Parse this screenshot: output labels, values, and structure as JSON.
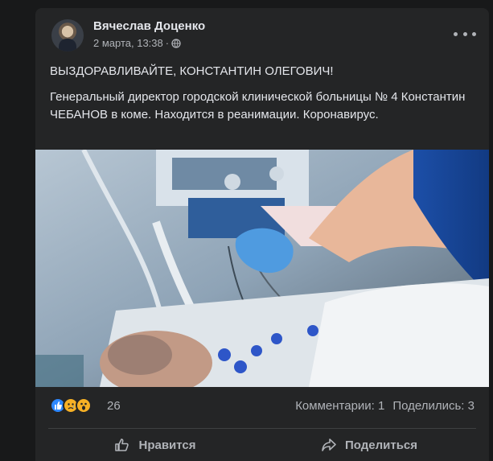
{
  "post": {
    "author": "Вячеслав Доценко",
    "date": "2 марта, 13:38",
    "separator": "·",
    "title": "ВЫЗДОРАВЛИВАЙТЕ, КОНСТАНТИН ОЛЕГОВИЧ!",
    "body": "Генеральный директор городской клинической больницы № 4 Константин ЧЕБАНОВ в коме. Находится в реанимации. Коронавирус."
  },
  "reactions": {
    "icons": [
      "like-icon",
      "sad-icon",
      "wow-icon"
    ],
    "count": "26",
    "comments": "Комментарии: 1",
    "shares": "Поделились: 3"
  },
  "actions": {
    "like_label": "Нравится",
    "share_label": "Поделиться"
  },
  "colors": {
    "background": "#18191a",
    "card": "#242526",
    "like_blue": "#2d88ff",
    "reaction_yellow": "#f7b125",
    "text_primary": "#e4e6eb",
    "text_secondary": "#b0b3b8"
  }
}
